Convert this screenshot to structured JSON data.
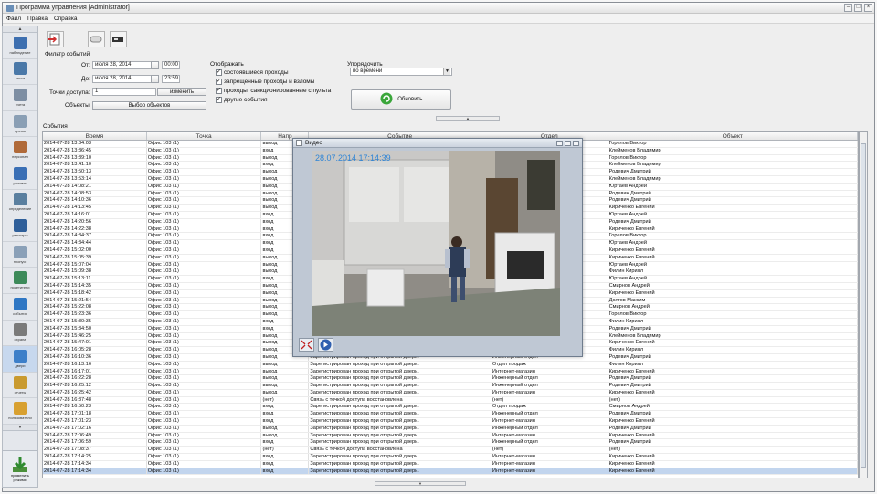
{
  "window": {
    "title": "Программа управления [Administrator]"
  },
  "menu": [
    "Файл",
    "Правка",
    "Справка"
  ],
  "sidebar": {
    "items": [
      {
        "label": "наблюдение",
        "color": "#3d6fb0"
      },
      {
        "label": "касса",
        "color": "#4a78a8"
      },
      {
        "label": "учета",
        "color": "#7d8ea3"
      },
      {
        "label": "время",
        "color": "#8a9fb5"
      },
      {
        "label": "персонал",
        "color": "#b06a3a"
      },
      {
        "label": "режимы",
        "color": "#3a6fb5"
      },
      {
        "label": "определение",
        "color": "#5a7f9f"
      },
      {
        "label": "регистры",
        "color": "#2f5f9a"
      },
      {
        "label": "пропуск",
        "color": "#8aa0b8"
      },
      {
        "label": "посетители",
        "color": "#3d8a5a"
      },
      {
        "label": "события",
        "color": "#2f77c4"
      },
      {
        "label": "охрана",
        "color": "#7a7a7a"
      },
      {
        "label": "двери",
        "color": "#3d7fc9"
      },
      {
        "label": "отчеты",
        "color": "#c99a2f"
      },
      {
        "label": "пользователи",
        "color": "#d8a030"
      }
    ],
    "active_index": 12,
    "bottom_label": "применить\nрежимы"
  },
  "filter": {
    "caption": "Фильтр событий",
    "from_label": "От:",
    "from_date": "июля 28, 2014",
    "from_time": "00:00",
    "to_label": "До:",
    "to_date": "июля 28, 2014",
    "to_time": "23:59",
    "access_points_label": "Точки доступа:",
    "access_points_value": "1",
    "change_button": "изменить",
    "objects_label": "Объекты:",
    "objects_button": "Выбор объектов",
    "display_label": "Отображать",
    "display_options": [
      {
        "label": "состоявшиеся проходы",
        "checked": true
      },
      {
        "label": "запрещенные проходы и взломы",
        "checked": true
      },
      {
        "label": "проходы, санкционированные с пульта",
        "checked": true
      },
      {
        "label": "другие события",
        "checked": true
      }
    ],
    "sort_label": "Упорядочить",
    "sort_value": "по времени",
    "refresh_button": "Обновить"
  },
  "events": {
    "caption": "События",
    "columns": [
      "Время",
      "Точка",
      "Напр",
      "Событие",
      "Отдел",
      "Объект"
    ],
    "selected_index": 46,
    "rows": [
      [
        "2014-07-28 13:34:03",
        "Офис 103 (1)",
        "выход",
        "",
        "",
        "Горелов Виктор"
      ],
      [
        "2014-07-28 13:36:45",
        "Офис 103 (1)",
        "вход",
        "",
        "",
        "Клейменов Владимир"
      ],
      [
        "2014-07-28 13:39:10",
        "Офис 103 (1)",
        "выход",
        "",
        "",
        "Горелов Виктор"
      ],
      [
        "2014-07-28 13:41:10",
        "Офис 103 (1)",
        "вход",
        "",
        "",
        "Клейменов Владимир"
      ],
      [
        "2014-07-28 13:50:13",
        "Офис 103 (1)",
        "выход",
        "",
        "",
        "Родевич Дмитрий"
      ],
      [
        "2014-07-28 13:53:14",
        "Офис 103 (1)",
        "выход",
        "",
        "",
        "Клейменов Владимир"
      ],
      [
        "2014-07-28 14:08:21",
        "Офис 103 (1)",
        "выход",
        "",
        "",
        "Юртаев Андрей"
      ],
      [
        "2014-07-28 14:08:53",
        "Офис 103 (1)",
        "выход",
        "",
        "",
        "Родевич Дмитрий"
      ],
      [
        "2014-07-28 14:10:36",
        "Офис 103 (1)",
        "выход",
        "",
        "",
        "Родевич Дмитрий"
      ],
      [
        "2014-07-28 14:13:45",
        "Офис 103 (1)",
        "выход",
        "",
        "",
        "Кириченко Евгений"
      ],
      [
        "2014-07-28 14:16:01",
        "Офис 103 (1)",
        "вход",
        "",
        "",
        "Юртаев Андрей"
      ],
      [
        "2014-07-28 14:20:56",
        "Офис 103 (1)",
        "вход",
        "",
        "",
        "Родевич Дмитрий"
      ],
      [
        "2014-07-28 14:22:38",
        "Офис 103 (1)",
        "вход",
        "",
        "",
        "Кириченко Евгений"
      ],
      [
        "2014-07-28 14:34:37",
        "Офис 103 (1)",
        "вход",
        "",
        "",
        "Горелов Виктор"
      ],
      [
        "2014-07-28 14:34:44",
        "Офис 103 (1)",
        "вход",
        "",
        "",
        "Юртаев Андрей"
      ],
      [
        "2014-07-28 15:02:00",
        "Офис 103 (1)",
        "вход",
        "",
        "",
        "Кириченко Евгений"
      ],
      [
        "2014-07-28 15:05:39",
        "Офис 103 (1)",
        "выход",
        "",
        "",
        "Кириченко Евгений"
      ],
      [
        "2014-07-28 15:07:04",
        "Офис 103 (1)",
        "выход",
        "",
        "",
        "Юртаев Андрей"
      ],
      [
        "2014-07-28 15:09:38",
        "Офис 103 (1)",
        "выход",
        "",
        "",
        "Филин Кирилл"
      ],
      [
        "2014-07-28 15:13:11",
        "Офис 103 (1)",
        "вход",
        "",
        "",
        "Юртаев Андрей"
      ],
      [
        "2014-07-28 15:14:35",
        "Офис 103 (1)",
        "выход",
        "",
        "",
        "Смирнов Андрей"
      ],
      [
        "2014-07-28 15:18:42",
        "Офис 103 (1)",
        "выход",
        "",
        "",
        "Кириченко Евгений"
      ],
      [
        "2014-07-28 15:21:54",
        "Офис 103 (1)",
        "выход",
        "",
        "",
        "Долгов Максим"
      ],
      [
        "2014-07-28 15:22:08",
        "Офис 103 (1)",
        "выход",
        "",
        "",
        "Смирнов Андрей"
      ],
      [
        "2014-07-28 15:23:36",
        "Офис 103 (1)",
        "выход",
        "",
        "",
        "Горелов Виктор"
      ],
      [
        "2014-07-28 15:30:35",
        "Офис 103 (1)",
        "вход",
        "",
        "",
        "Филин Кирилл"
      ],
      [
        "2014-07-28 15:34:50",
        "Офис 103 (1)",
        "вход",
        "",
        "",
        "Родевич Дмитрий"
      ],
      [
        "2014-07-28 15:46:25",
        "Офис 103 (1)",
        "выход",
        "",
        "",
        "Клейменов Владимир"
      ],
      [
        "2014-07-28 15:47:01",
        "Офис 103 (1)",
        "выход",
        "",
        "",
        "Кириченко Евгений"
      ],
      [
        "2014-07-28 16:05:28",
        "Офис 103 (1)",
        "выход",
        "Зарегистрирован проход при открытой двери.",
        "Отдел продаж",
        "Филин Кирилл"
      ],
      [
        "2014-07-28 16:10:36",
        "Офис 103 (1)",
        "выход",
        "Зарегистрирован проход при открытой двери.",
        "Инженерный отдел",
        "Родевич Дмитрий"
      ],
      [
        "2014-07-28 16:13:16",
        "Офис 103 (1)",
        "выход",
        "Зарегистрирован проход при открытой двери.",
        "Отдел продаж",
        "Филин Кирилл"
      ],
      [
        "2014-07-28 16:17:01",
        "Офис 103 (1)",
        "выход",
        "Зарегистрирован проход при открытой двери.",
        "Интернет-магазин",
        "Кириченко Евгений"
      ],
      [
        "2014-07-28 16:22:28",
        "Офис 103 (1)",
        "выход",
        "Зарегистрирован проход при открытой двери.",
        "Инженерный отдел",
        "Родевич Дмитрий"
      ],
      [
        "2014-07-28 16:25:12",
        "Офис 103 (1)",
        "выход",
        "Зарегистрирован проход при открытой двери.",
        "Инженерный отдел",
        "Родевич Дмитрий"
      ],
      [
        "2014-07-28 16:25:42",
        "Офис 103 (1)",
        "выход",
        "Зарегистрирован проход при открытой двери.",
        "Интернет-магазин",
        "Кириченко Евгений"
      ],
      [
        "2014-07-28 16:37:48",
        "Офис 103 (1)",
        "(нет)",
        "Связь с точкой доступа восстановлена",
        "(нет)",
        "(нет)"
      ],
      [
        "2014-07-28 16:50:23",
        "Офис 103 (1)",
        "вход",
        "Зарегистрирован проход при открытой двери.",
        "Отдел продаж",
        "Смирнов Андрей"
      ],
      [
        "2014-07-28 17:01:18",
        "Офис 103 (1)",
        "вход",
        "Зарегистрирован проход при открытой двери.",
        "Инженерный отдел",
        "Родевич Дмитрий"
      ],
      [
        "2014-07-28 17:01:23",
        "Офис 103 (1)",
        "вход",
        "Зарегистрирован проход при открытой двери.",
        "Интернет-магазин",
        "Кириченко Евгений"
      ],
      [
        "2014-07-28 17:02:16",
        "Офис 103 (1)",
        "выход",
        "Зарегистрирован проход при открытой двери.",
        "Инженерный отдел",
        "Родевич Дмитрий"
      ],
      [
        "2014-07-28 17:06:49",
        "Офис 103 (1)",
        "выход",
        "Зарегистрирован проход при открытой двери.",
        "Интернет-магазин",
        "Кириченко Евгений"
      ],
      [
        "2014-07-28 17:06:59",
        "Офис 103 (1)",
        "вход",
        "Зарегистрирован проход при открытой двери.",
        "Инженерный отдел",
        "Родевич Дмитрий"
      ],
      [
        "2014-07-28 17:08:37",
        "Офис 103 (1)",
        "(нет)",
        "Связь с точкой доступа восстановлена",
        "(нет)",
        "(нет)"
      ],
      [
        "2014-07-28 17:14:25",
        "Офис 103 (1)",
        "вход",
        "Зарегистрирован проход при открытой двери.",
        "Интернет-магазин",
        "Кириченко Евгений"
      ],
      [
        "2014-07-28 17:14:34",
        "Офис 103 (1)",
        "вход",
        "Зарегистрирован проход при открытой двери.",
        "Интернет-магазин",
        "Кириченко Евгений"
      ],
      [
        "2014-07-28 17:14:34",
        "Офис 103 (1)",
        "вход",
        "Зарегистрирован проход при открытой двери.",
        "Интернет-магазин",
        "Кириченко Евгений"
      ]
    ]
  },
  "video": {
    "title": "Видео",
    "timestamp": "28.07.2014 17:14:39",
    "stamp_color": "#2e84d6"
  }
}
